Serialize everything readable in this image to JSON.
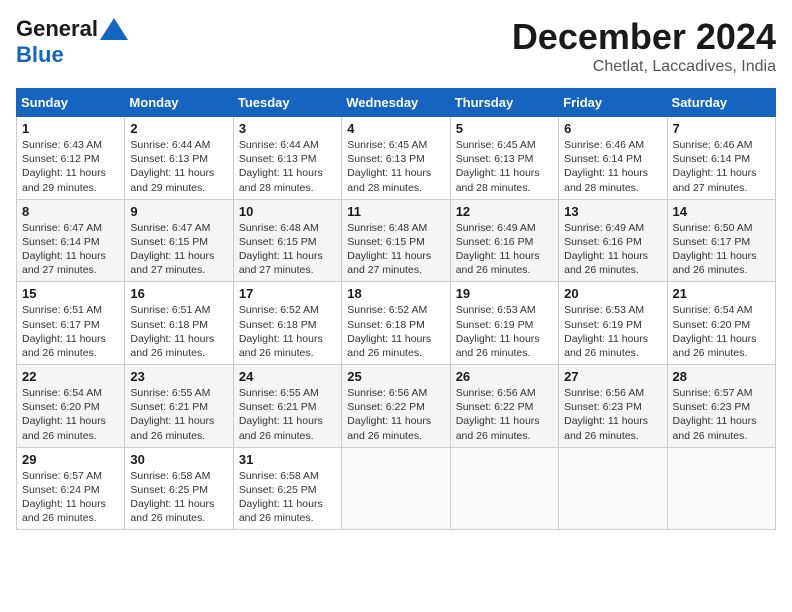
{
  "logo": {
    "text1": "General",
    "text2": "Blue"
  },
  "title": {
    "month_year": "December 2024",
    "location": "Chetlat, Laccadives, India"
  },
  "weekdays": [
    "Sunday",
    "Monday",
    "Tuesday",
    "Wednesday",
    "Thursday",
    "Friday",
    "Saturday"
  ],
  "weeks": [
    [
      {
        "day": "1",
        "info": "Sunrise: 6:43 AM\nSunset: 6:12 PM\nDaylight: 11 hours and 29 minutes."
      },
      {
        "day": "2",
        "info": "Sunrise: 6:44 AM\nSunset: 6:13 PM\nDaylight: 11 hours and 29 minutes."
      },
      {
        "day": "3",
        "info": "Sunrise: 6:44 AM\nSunset: 6:13 PM\nDaylight: 11 hours and 28 minutes."
      },
      {
        "day": "4",
        "info": "Sunrise: 6:45 AM\nSunset: 6:13 PM\nDaylight: 11 hours and 28 minutes."
      },
      {
        "day": "5",
        "info": "Sunrise: 6:45 AM\nSunset: 6:13 PM\nDaylight: 11 hours and 28 minutes."
      },
      {
        "day": "6",
        "info": "Sunrise: 6:46 AM\nSunset: 6:14 PM\nDaylight: 11 hours and 28 minutes."
      },
      {
        "day": "7",
        "info": "Sunrise: 6:46 AM\nSunset: 6:14 PM\nDaylight: 11 hours and 27 minutes."
      }
    ],
    [
      {
        "day": "8",
        "info": "Sunrise: 6:47 AM\nSunset: 6:14 PM\nDaylight: 11 hours and 27 minutes."
      },
      {
        "day": "9",
        "info": "Sunrise: 6:47 AM\nSunset: 6:15 PM\nDaylight: 11 hours and 27 minutes."
      },
      {
        "day": "10",
        "info": "Sunrise: 6:48 AM\nSunset: 6:15 PM\nDaylight: 11 hours and 27 minutes."
      },
      {
        "day": "11",
        "info": "Sunrise: 6:48 AM\nSunset: 6:15 PM\nDaylight: 11 hours and 27 minutes."
      },
      {
        "day": "12",
        "info": "Sunrise: 6:49 AM\nSunset: 6:16 PM\nDaylight: 11 hours and 26 minutes."
      },
      {
        "day": "13",
        "info": "Sunrise: 6:49 AM\nSunset: 6:16 PM\nDaylight: 11 hours and 26 minutes."
      },
      {
        "day": "14",
        "info": "Sunrise: 6:50 AM\nSunset: 6:17 PM\nDaylight: 11 hours and 26 minutes."
      }
    ],
    [
      {
        "day": "15",
        "info": "Sunrise: 6:51 AM\nSunset: 6:17 PM\nDaylight: 11 hours and 26 minutes."
      },
      {
        "day": "16",
        "info": "Sunrise: 6:51 AM\nSunset: 6:18 PM\nDaylight: 11 hours and 26 minutes."
      },
      {
        "day": "17",
        "info": "Sunrise: 6:52 AM\nSunset: 6:18 PM\nDaylight: 11 hours and 26 minutes."
      },
      {
        "day": "18",
        "info": "Sunrise: 6:52 AM\nSunset: 6:18 PM\nDaylight: 11 hours and 26 minutes."
      },
      {
        "day": "19",
        "info": "Sunrise: 6:53 AM\nSunset: 6:19 PM\nDaylight: 11 hours and 26 minutes."
      },
      {
        "day": "20",
        "info": "Sunrise: 6:53 AM\nSunset: 6:19 PM\nDaylight: 11 hours and 26 minutes."
      },
      {
        "day": "21",
        "info": "Sunrise: 6:54 AM\nSunset: 6:20 PM\nDaylight: 11 hours and 26 minutes."
      }
    ],
    [
      {
        "day": "22",
        "info": "Sunrise: 6:54 AM\nSunset: 6:20 PM\nDaylight: 11 hours and 26 minutes."
      },
      {
        "day": "23",
        "info": "Sunrise: 6:55 AM\nSunset: 6:21 PM\nDaylight: 11 hours and 26 minutes."
      },
      {
        "day": "24",
        "info": "Sunrise: 6:55 AM\nSunset: 6:21 PM\nDaylight: 11 hours and 26 minutes."
      },
      {
        "day": "25",
        "info": "Sunrise: 6:56 AM\nSunset: 6:22 PM\nDaylight: 11 hours and 26 minutes."
      },
      {
        "day": "26",
        "info": "Sunrise: 6:56 AM\nSunset: 6:22 PM\nDaylight: 11 hours and 26 minutes."
      },
      {
        "day": "27",
        "info": "Sunrise: 6:56 AM\nSunset: 6:23 PM\nDaylight: 11 hours and 26 minutes."
      },
      {
        "day": "28",
        "info": "Sunrise: 6:57 AM\nSunset: 6:23 PM\nDaylight: 11 hours and 26 minutes."
      }
    ],
    [
      {
        "day": "29",
        "info": "Sunrise: 6:57 AM\nSunset: 6:24 PM\nDaylight: 11 hours and 26 minutes."
      },
      {
        "day": "30",
        "info": "Sunrise: 6:58 AM\nSunset: 6:25 PM\nDaylight: 11 hours and 26 minutes."
      },
      {
        "day": "31",
        "info": "Sunrise: 6:58 AM\nSunset: 6:25 PM\nDaylight: 11 hours and 26 minutes."
      },
      {
        "day": "",
        "info": ""
      },
      {
        "day": "",
        "info": ""
      },
      {
        "day": "",
        "info": ""
      },
      {
        "day": "",
        "info": ""
      }
    ]
  ]
}
